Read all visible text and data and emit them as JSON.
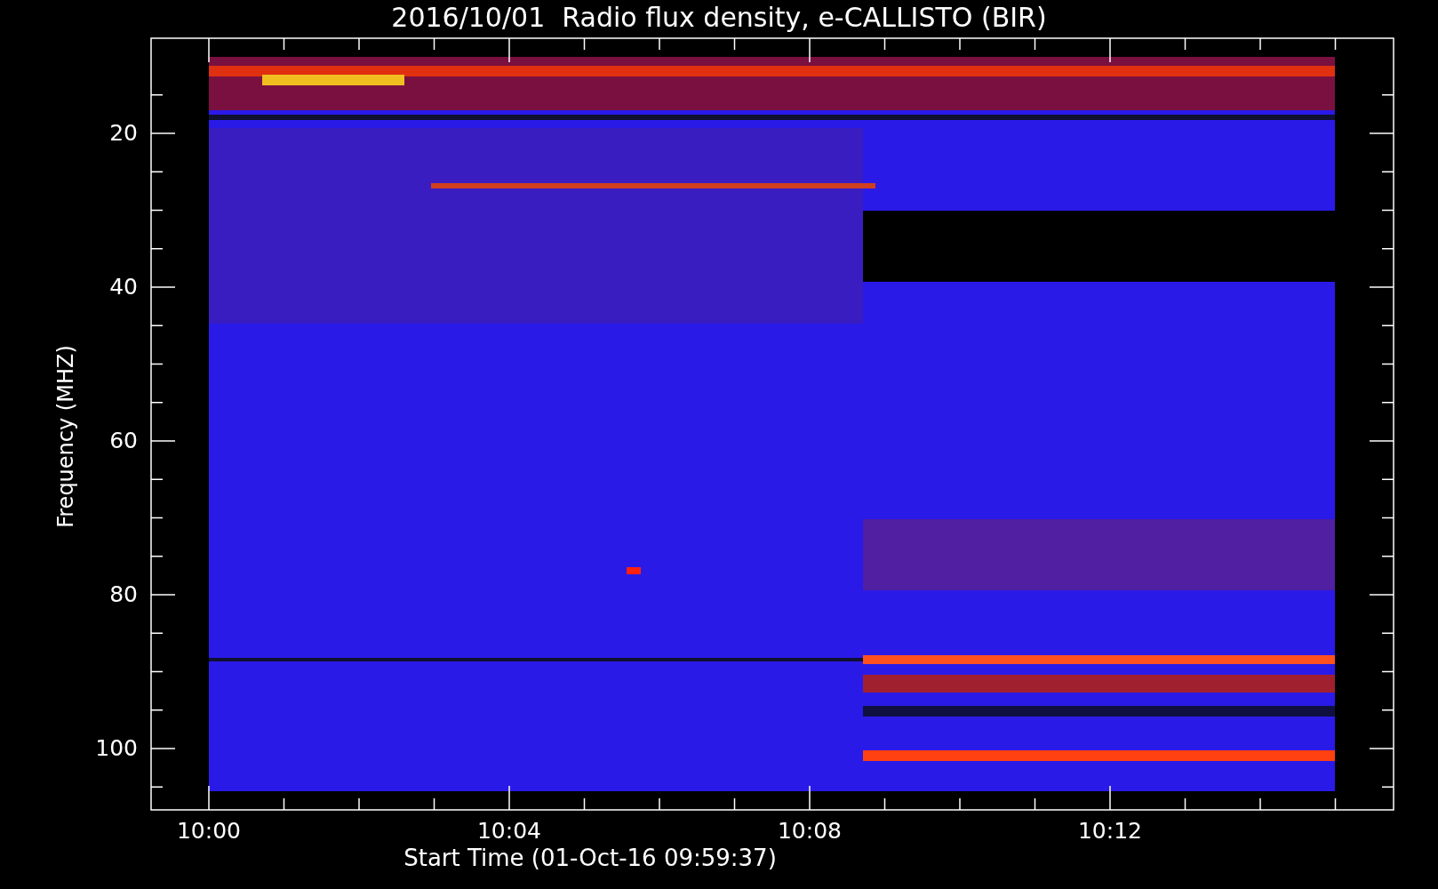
{
  "title": "2016/10/01  Radio flux density, e-CALLISTO (BIR)",
  "y_axis": {
    "label": "Frequency (MHZ)",
    "ticks": [
      "20",
      "40",
      "60",
      "80",
      "100"
    ]
  },
  "x_axis": {
    "label": "Start Time (01-Oct-16 09:59:37)",
    "ticks": [
      "10:00",
      "10:04",
      "10:08",
      "10:12"
    ]
  }
}
